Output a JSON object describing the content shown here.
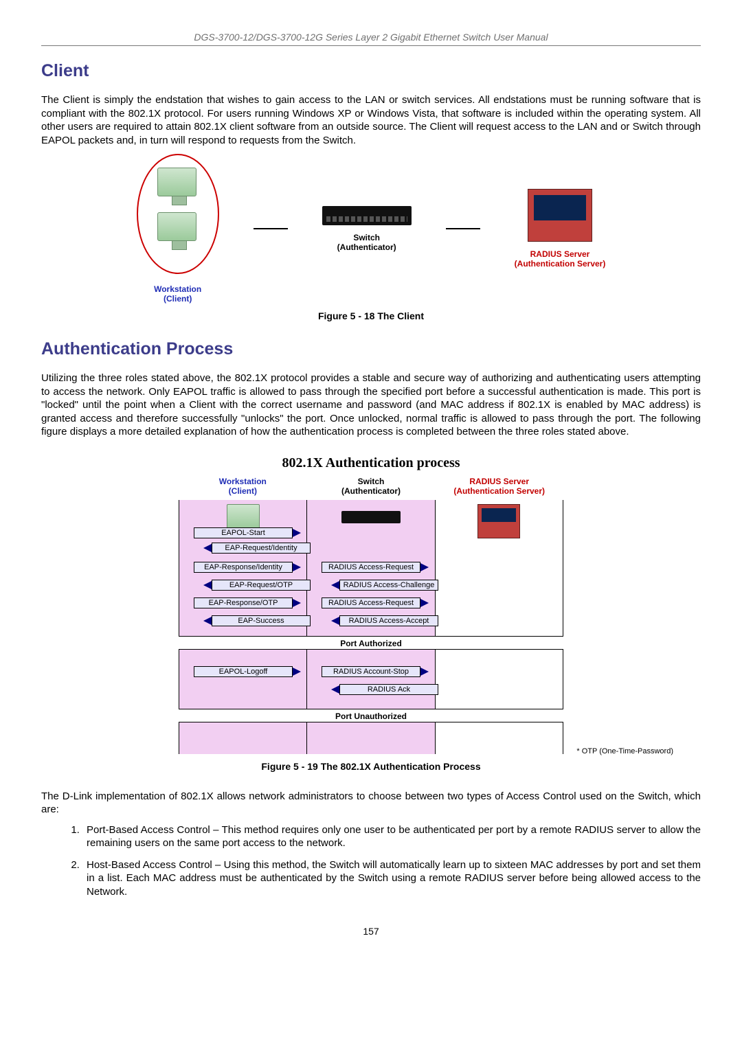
{
  "header": "DGS-3700-12/DGS-3700-12G Series Layer 2 Gigabit Ethernet Switch User Manual",
  "client": {
    "heading": "Client",
    "para": "The Client is simply the endstation that wishes to gain access to the LAN or switch services. All endstations must be running software that is compliant with the 802.1X protocol. For users running Windows XP or Windows Vista, that software is included within the operating system. All other users are required to attain 802.1X client software from an outside source. The Client will request access to the LAN and or Switch through EAPOL packets and, in turn will respond to requests from the Switch."
  },
  "fig18": {
    "workstation_label1": "Workstation",
    "workstation_label2": "(Client)",
    "switch_label1": "Switch",
    "switch_label2": "(Authenticator)",
    "radius_label1": "RADIUS Server",
    "radius_label2": "(Authentication Server)",
    "caption": "Figure 5 - 18 The Client"
  },
  "auth": {
    "heading": "Authentication Process",
    "para": "Utilizing the three roles stated above, the 802.1X protocol provides a stable and secure way of authorizing and authenticating users attempting to access the network. Only EAPOL traffic is allowed to pass through the specified port before a successful authentication is made. This port is \"locked\" until the point when a Client with the correct username and password (and MAC address if 802.1X is enabled by MAC address) is granted access and therefore successfully \"unlocks\" the port. Once unlocked, normal traffic is allowed to pass through the port. The following figure displays a more detailed explanation of how the authentication process is completed between the three roles stated above."
  },
  "fig19": {
    "title": "802.1X Authentication process",
    "hdr_ws1": "Workstation",
    "hdr_ws2": "(Client)",
    "hdr_sw1": "Switch",
    "hdr_sw2": "(Authenticator)",
    "hdr_rs1": "RADIUS Server",
    "hdr_rs2": "(Authentication Server)",
    "msgs_left": [
      "EAPOL-Start",
      "EAP-Request/Identity",
      "EAP-Response/Identity",
      "EAP-Request/OTP",
      "EAP-Response/OTP",
      "EAP-Success",
      "EAPOL-Logoff"
    ],
    "msgs_right": [
      "RADIUS Access-Request",
      "RADIUS Access-Challenge",
      "RADIUS Access-Request",
      "RADIUS Access-Accept",
      "RADIUS Account-Stop",
      "RADIUS Ack"
    ],
    "sep1": "Port Authorized",
    "sep2": "Port Unauthorized",
    "footnote": "* OTP (One-Time-Password)",
    "caption": "Figure 5 - 19 The 802.1X Authentication Process"
  },
  "impl_para": "The D-Link implementation of 802.1X allows network administrators to choose between two types of Access Control used on the Switch, which are:",
  "list": {
    "item1": "Port-Based Access Control – This method requires only one user to be authenticated per port by a remote RADIUS server to allow the remaining users on the same port access to the network.",
    "item2": "Host-Based Access Control – Using this method, the Switch will automatically learn up to sixteen MAC addresses by port and set them in a list. Each MAC address must be authenticated by the Switch using a remote RADIUS server before being allowed access to the Network."
  },
  "page_number": "157"
}
